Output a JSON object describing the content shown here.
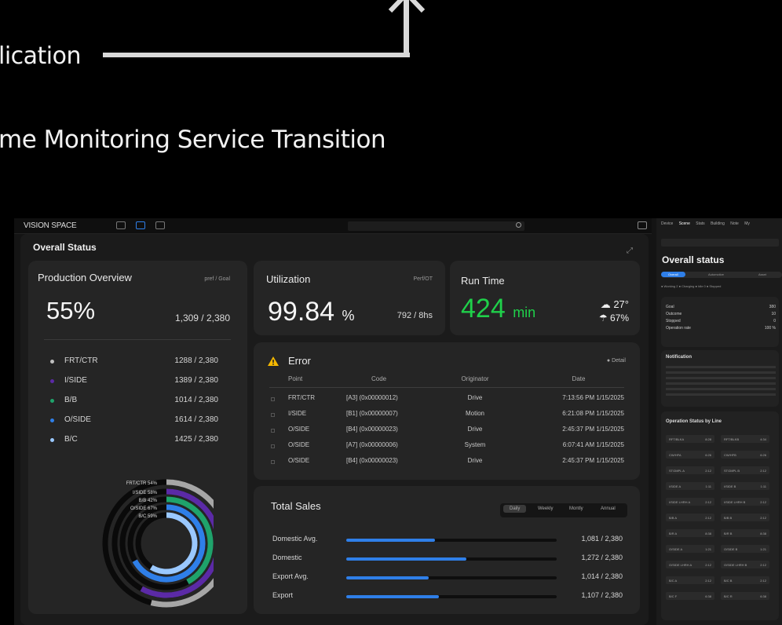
{
  "header": {
    "line1": "lication",
    "line2": "me Monitoring Service Transition"
  },
  "topbar": {
    "brand": "VISION SPACE"
  },
  "panel": {
    "title": "Overall Status"
  },
  "production": {
    "title": "Production Overview",
    "sub": "pref / Goal",
    "percent": "55%",
    "ratio": "1,309 / 2,380",
    "rows": [
      {
        "name": "FRT/CTR",
        "value": "1288 / 2,380",
        "color": "#bfbfbf"
      },
      {
        "name": "I/SIDE",
        "value": "1389 / 2,380",
        "color": "#5b2aa6"
      },
      {
        "name": "B/B",
        "value": "1014 / 2,380",
        "color": "#1fa36b"
      },
      {
        "name": "O/SIDE",
        "value": "1614 / 2,380",
        "color": "#2f7fe8"
      },
      {
        "name": "B/C",
        "value": "1425 / 2,380",
        "color": "#9ac8ff"
      }
    ],
    "donut": [
      {
        "label": "FRT/CTR",
        "pct": "54%",
        "fraction": 0.54,
        "color": "#a6a6a6"
      },
      {
        "label": "I/SIDE",
        "pct": "58%",
        "fraction": 0.58,
        "color": "#5b2aa6"
      },
      {
        "label": "B/B",
        "pct": "42%",
        "fraction": 0.42,
        "color": "#1fa36b"
      },
      {
        "label": "O/SIDE",
        "pct": "67%",
        "fraction": 0.67,
        "color": "#2f7fe8"
      },
      {
        "label": "B/C",
        "pct": "59%",
        "fraction": 0.59,
        "color": "#9ac8ff"
      }
    ]
  },
  "utilization": {
    "title": "Utilization",
    "sub": "Perf/OT",
    "value": "99.84",
    "unit": "%",
    "ratio": "792 / 8hs"
  },
  "runtime": {
    "title": "Run Time",
    "value": "424",
    "unit": "min",
    "temp": "27°",
    "humidity": "67%"
  },
  "error": {
    "title": "Error",
    "detail": "Detail",
    "headers": [
      "Point",
      "Code",
      "Originator",
      "Date"
    ],
    "rows": [
      [
        "FRT/CTR",
        "[A3] (0x00000012)",
        "Drive",
        "7:13:56 PM 1/15/2025"
      ],
      [
        "I/SIDE",
        "[B1] (0x00000007)",
        "Motion",
        "6:21:08 PM 1/15/2025"
      ],
      [
        "O/SIDE",
        "[B4] (0x00000023)",
        "Drive",
        "2:45:37 PM 1/15/2025"
      ],
      [
        "O/SIDE",
        "[A7] (0x00000006)",
        "System",
        "6:07:41 AM 1/15/2025"
      ],
      [
        "O/SIDE",
        "[B4] (0x00000023)",
        "Drive",
        "2:45:37 PM 1/15/2025"
      ]
    ]
  },
  "sales": {
    "title": "Total Sales",
    "tabs": [
      "Daily",
      "Weekly",
      "Montly",
      "Annual"
    ],
    "rows": [
      {
        "name": "Domestic Avg.",
        "value": "1,081 / 2,380",
        "fraction": 0.42
      },
      {
        "name": "Domestic",
        "value": "1,272 / 2,380",
        "fraction": 0.57
      },
      {
        "name": "Export Avg.",
        "value": "1,014 / 2,380",
        "fraction": 0.39
      },
      {
        "name": "Export",
        "value": "1,107 / 2,380",
        "fraction": 0.44
      }
    ]
  },
  "side": {
    "nav": [
      "Device",
      "Scene",
      "Stats",
      "Building",
      "Note",
      "My"
    ],
    "title": "Overall status",
    "tabs": [
      "Overall",
      "Automotive",
      "Asset"
    ],
    "legend": "● Working 2  ● Charging  ● Idle 0  ● Stopped",
    "kv": [
      {
        "k": "Goal",
        "v": "380"
      },
      {
        "k": "Outcome",
        "v": "10"
      },
      {
        "k": "Stopped",
        "v": "0"
      },
      {
        "k": "Operation rate",
        "v": "100 %"
      }
    ],
    "notif_title": "Notification",
    "line_title": "Operation Status by Line",
    "cells": [
      [
        "RFT/BLKA",
        "8:28"
      ],
      [
        "RFT/BLKB",
        "4:34"
      ],
      [
        "CW/HFA",
        "6:26"
      ],
      [
        "CW/HFB",
        "6:26"
      ],
      [
        "STGMPL A",
        "2:12"
      ],
      [
        "STGMPL B",
        "2:12"
      ],
      [
        "I/SIDE A",
        "1:11"
      ],
      [
        "I/SIDE B",
        "1:11"
      ],
      [
        "I/SIDE LHRH A",
        "2:12"
      ],
      [
        "I/SIDE LHRH B",
        "2:12"
      ],
      [
        "B/B A",
        "2:12"
      ],
      [
        "B/B B",
        "2:12"
      ],
      [
        "B/R A",
        "8:38"
      ],
      [
        "B/R B",
        "8:38"
      ],
      [
        "O/SIDE A",
        "1:21"
      ],
      [
        "O/SIDE B",
        "1:21"
      ],
      [
        "O/SIDE LHRH A",
        "2:12"
      ],
      [
        "O/SIDE LHRH B",
        "2:12"
      ],
      [
        "B/C A",
        "2:12"
      ],
      [
        "B/C B",
        "2:12"
      ],
      [
        "B/C F",
        "6:38"
      ],
      [
        "B/C R",
        "6:38"
      ]
    ]
  }
}
